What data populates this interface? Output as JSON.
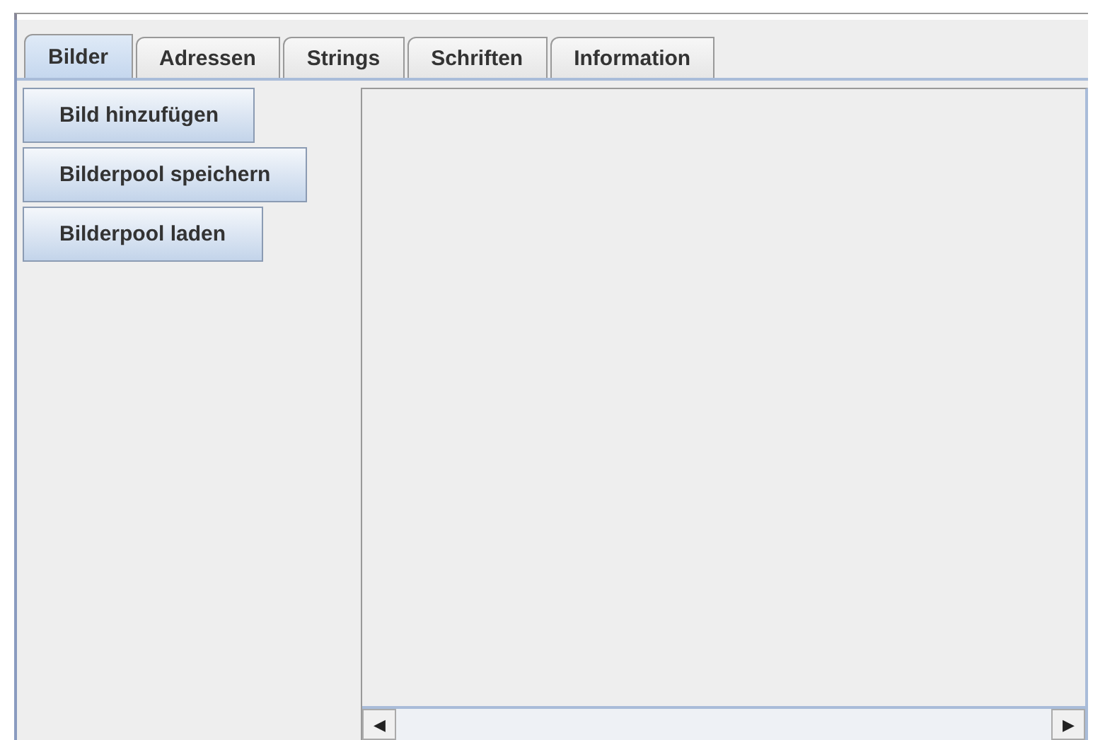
{
  "tabs": [
    {
      "label": "Bilder",
      "selected": true
    },
    {
      "label": "Adressen",
      "selected": false
    },
    {
      "label": "Strings",
      "selected": false
    },
    {
      "label": "Schriften",
      "selected": false
    },
    {
      "label": "Information",
      "selected": false
    }
  ],
  "buttons": [
    "Bild hinzufügen",
    "Bilderpool speichern",
    "Bilderpool laden"
  ],
  "scroll_left": "◀",
  "scroll_right": "▶"
}
